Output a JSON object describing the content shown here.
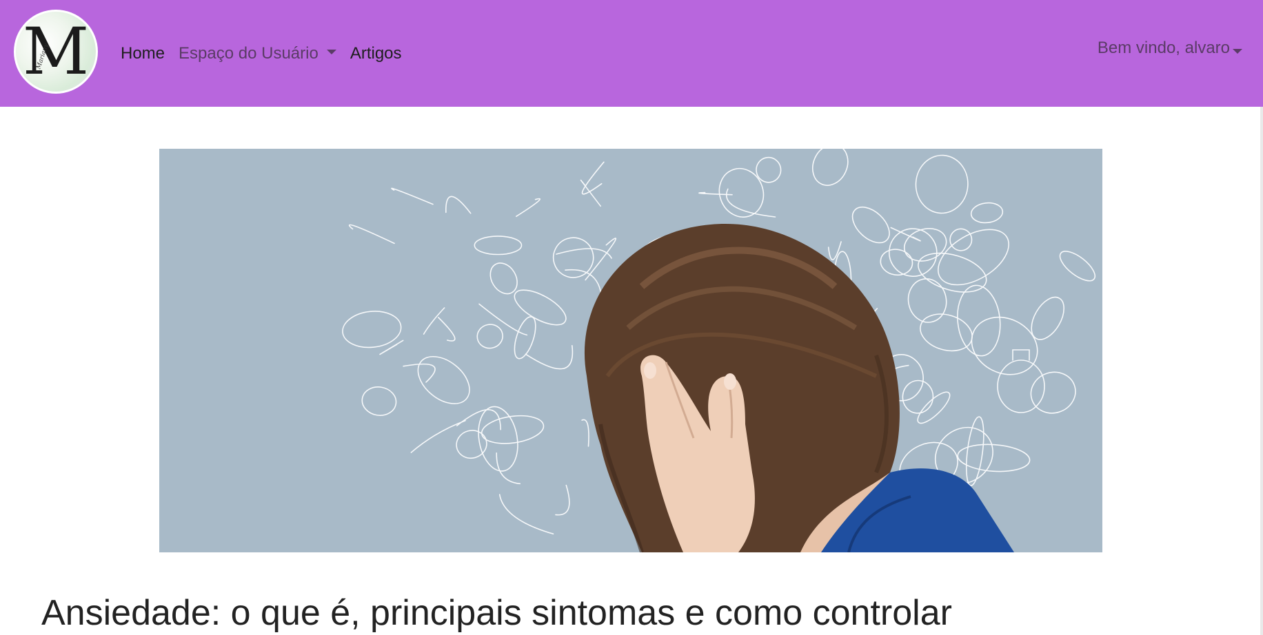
{
  "colors": {
    "navbar_bg": "#b866dd",
    "nav_text_dark": "#1e1e1e",
    "nav_text_muted": "#5a3b66",
    "hero_bg": "#a8bac8",
    "title_text": "#222222"
  },
  "logo": {
    "letter": "M",
    "script_text": "Mariany"
  },
  "nav": {
    "home_label": "Home",
    "user_space_label": "Espaço do Usuário",
    "articles_label": "Artigos"
  },
  "user_menu": {
    "greeting": "Bem vindo, alvaro"
  },
  "hero_image": {
    "description_icon": "stressed-woman-hero-image"
  },
  "article": {
    "title": "Ansiedade: o que é, principais sintomas e como controlar"
  }
}
